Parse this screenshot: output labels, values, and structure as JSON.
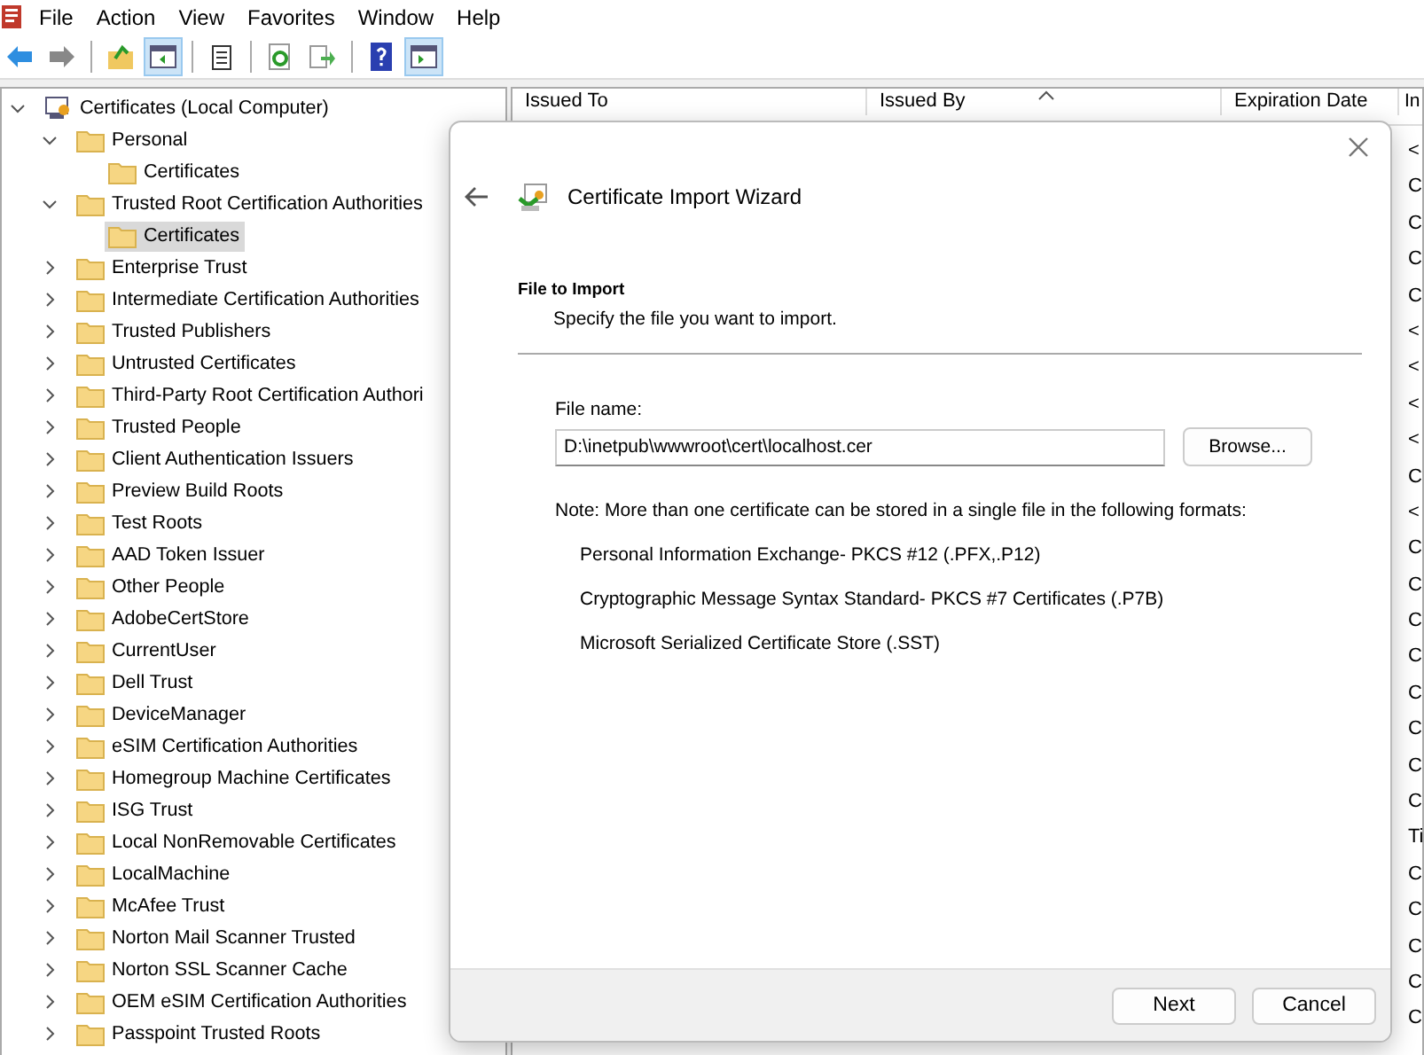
{
  "menu": [
    "File",
    "Action",
    "View",
    "Favorites",
    "Window",
    "Help"
  ],
  "toolbar": [
    [
      {
        "kind": "back",
        "pressed": false
      },
      {
        "kind": "forward",
        "pressed": false
      }
    ],
    [
      {
        "kind": "up",
        "pressed": false
      },
      {
        "kind": "tree",
        "pressed": true
      }
    ],
    [
      {
        "kind": "clipboard",
        "pressed": false
      }
    ],
    [
      {
        "kind": "refresh",
        "pressed": false
      },
      {
        "kind": "export",
        "pressed": false
      }
    ],
    [
      {
        "kind": "help",
        "pressed": false
      },
      {
        "kind": "pane",
        "pressed": true
      }
    ]
  ],
  "tree": [
    {
      "label": "Certificates (Local Computer)",
      "kind": "root",
      "expanded": true,
      "selected": false,
      "children": [
        {
          "label": "Personal",
          "kind": "folder",
          "expanded": true,
          "selected": false,
          "children": [
            {
              "label": "Certificates",
              "kind": "folder",
              "selected": false
            }
          ]
        },
        {
          "label": "Trusted Root Certification Authorities",
          "kind": "folder",
          "expanded": true,
          "selected": false,
          "children": [
            {
              "label": "Certificates",
              "kind": "folder",
              "selected": true
            }
          ]
        },
        {
          "label": "Enterprise Trust",
          "kind": "folder",
          "expanded": false,
          "selected": false
        },
        {
          "label": "Intermediate Certification Authorities",
          "kind": "folder",
          "expanded": false,
          "selected": false
        },
        {
          "label": "Trusted Publishers",
          "kind": "folder",
          "expanded": false,
          "selected": false
        },
        {
          "label": "Untrusted Certificates",
          "kind": "folder",
          "expanded": false,
          "selected": false
        },
        {
          "label": "Third-Party Root Certification Authori",
          "kind": "folder",
          "expanded": false,
          "selected": false
        },
        {
          "label": "Trusted People",
          "kind": "folder",
          "expanded": false,
          "selected": false
        },
        {
          "label": "Client Authentication Issuers",
          "kind": "folder",
          "expanded": false,
          "selected": false
        },
        {
          "label": "Preview Build Roots",
          "kind": "folder",
          "expanded": false,
          "selected": false
        },
        {
          "label": "Test Roots",
          "kind": "folder",
          "expanded": false,
          "selected": false
        },
        {
          "label": "AAD Token Issuer",
          "kind": "folder",
          "expanded": false,
          "selected": false
        },
        {
          "label": "Other People",
          "kind": "folder",
          "expanded": false,
          "selected": false
        },
        {
          "label": "AdobeCertStore",
          "kind": "folder",
          "expanded": false,
          "selected": false
        },
        {
          "label": "CurrentUser",
          "kind": "folder",
          "expanded": false,
          "selected": false
        },
        {
          "label": "Dell Trust",
          "kind": "folder",
          "expanded": false,
          "selected": false
        },
        {
          "label": "DeviceManager",
          "kind": "folder",
          "expanded": false,
          "selected": false
        },
        {
          "label": "eSIM Certification Authorities",
          "kind": "folder",
          "expanded": false,
          "selected": false
        },
        {
          "label": "Homegroup Machine Certificates",
          "kind": "folder",
          "expanded": false,
          "selected": false
        },
        {
          "label": "ISG Trust",
          "kind": "folder",
          "expanded": false,
          "selected": false
        },
        {
          "label": "Local NonRemovable Certificates",
          "kind": "folder",
          "expanded": false,
          "selected": false
        },
        {
          "label": "LocalMachine",
          "kind": "folder",
          "expanded": false,
          "selected": false
        },
        {
          "label": "McAfee Trust",
          "kind": "folder",
          "expanded": false,
          "selected": false
        },
        {
          "label": "Norton Mail Scanner Trusted",
          "kind": "folder",
          "expanded": false,
          "selected": false
        },
        {
          "label": "Norton SSL Scanner Cache",
          "kind": "folder",
          "expanded": false,
          "selected": false
        },
        {
          "label": "OEM eSIM Certification Authorities",
          "kind": "folder",
          "expanded": false,
          "selected": false
        },
        {
          "label": "Passpoint Trusted Roots",
          "kind": "folder",
          "expanded": false,
          "selected": false
        }
      ]
    }
  ],
  "table": {
    "columns": [
      "Issued To",
      "Issued By",
      "Expiration Date",
      "In"
    ],
    "column_4": [
      "<",
      "C",
      "C",
      "C",
      "C",
      "<",
      "<",
      "<",
      "<",
      "C",
      "<",
      "C",
      "C",
      "C",
      "C",
      "C",
      "C",
      "C",
      "C",
      "Ti",
      "C",
      "C",
      "C",
      "C",
      "C"
    ]
  },
  "dialog": {
    "title": "Certificate Import Wizard",
    "heading": "File to Import",
    "subtitle": "Specify the file you want to import.",
    "file_label": "File name:",
    "file_value": "D:\\inetpub\\wwwroot\\cert\\localhost.cer",
    "browse": "Browse...",
    "note": "Note:  More than one certificate can be stored in a single file in the following formats:",
    "formats": [
      "Personal Information Exchange- PKCS #12 (.PFX,.P12)",
      "Cryptographic Message Syntax Standard- PKCS #7 Certificates (.P7B)",
      "Microsoft Serialized Certificate Store (.SST)"
    ],
    "buttons": [
      "Next",
      "Cancel"
    ]
  }
}
